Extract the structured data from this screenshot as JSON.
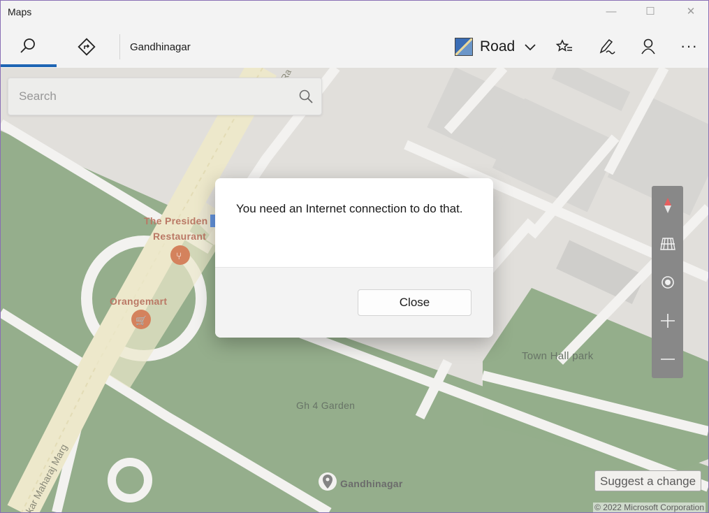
{
  "window": {
    "title": "Maps"
  },
  "titlebar": {
    "minimize_glyph": "—",
    "maximize_glyph": "☐",
    "close_glyph": "✕"
  },
  "toolbar": {
    "search_icon": "search-icon",
    "directions_icon": "directions-icon",
    "location_label": "Gandhinagar",
    "map_style": {
      "label": "Road",
      "icon": "map-style-icon"
    },
    "favorites_icon": "favorites-icon",
    "ink_icon": "ink-pen-icon",
    "account_icon": "person-icon",
    "more_glyph": "···"
  },
  "search": {
    "placeholder": "Search"
  },
  "map": {
    "labels": {
      "restaurant_line1": "The Presiden",
      "restaurant_line2": "Restaurant",
      "store": "Orangemart",
      "park": "Town Hall park",
      "garden": "Gh 4 Garden",
      "city": "Gandhinagar",
      "road": "nhankar Maharaj Marg",
      "road_top": "Ra"
    },
    "colors": {
      "park": "#6b8f5f",
      "road": "#f0efec",
      "building": "#c8c6c2",
      "accent": "#1e65b4",
      "poi": "#c4521f"
    }
  },
  "map_controls": [
    "compass-icon",
    "3d-view-icon",
    "my-location-icon",
    "zoom-in-icon",
    "zoom-out-icon"
  ],
  "dialog": {
    "message": "You need an Internet connection to do that.",
    "close_label": "Close"
  },
  "footer": {
    "suggest_label": "Suggest a change",
    "copyright": "© 2022 Microsoft Corporation"
  }
}
